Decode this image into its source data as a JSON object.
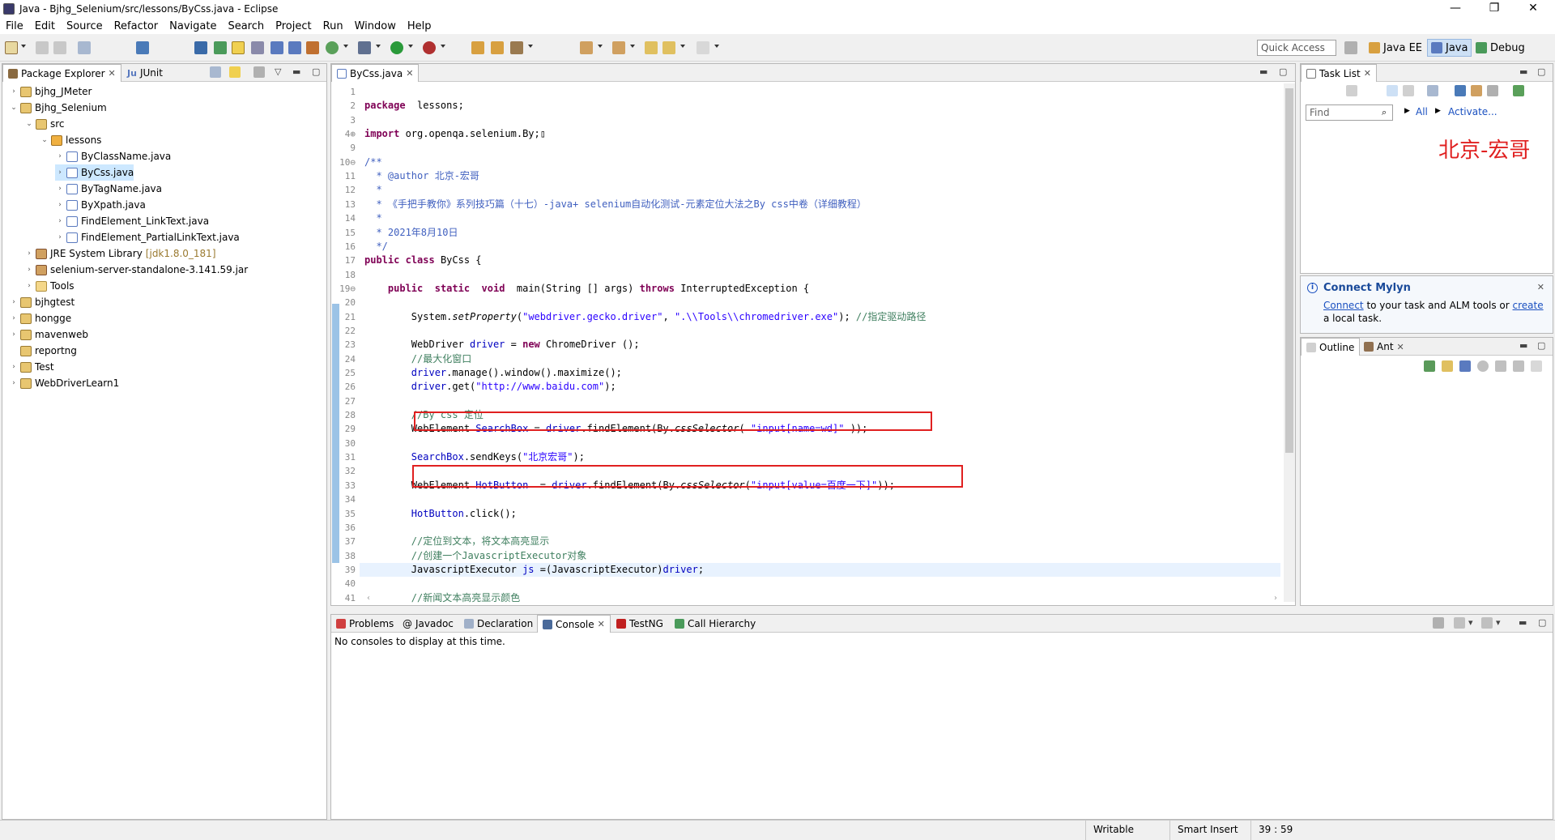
{
  "window": {
    "title": "Java - Bjhg_Selenium/src/lessons/ByCss.java - Eclipse",
    "minimize": "—",
    "maximize": "❐",
    "close": "✕"
  },
  "menu": [
    "File",
    "Edit",
    "Source",
    "Refactor",
    "Navigate",
    "Search",
    "Project",
    "Run",
    "Window",
    "Help"
  ],
  "quick_access": {
    "placeholder": "Quick Access"
  },
  "perspectives": [
    "Java EE",
    "Java",
    "Debug"
  ],
  "package_explorer": {
    "tabs": [
      "Package Explorer",
      "JUnit"
    ],
    "junit_prefix": "Ju",
    "tree": [
      {
        "label": "bjhg_JMeter",
        "level": 0,
        "twisty": "›",
        "icon": "proj"
      },
      {
        "label": "Bjhg_Selenium",
        "level": 0,
        "twisty": "⌄",
        "icon": "proj"
      },
      {
        "label": "src",
        "level": 1,
        "twisty": "⌄",
        "icon": "src"
      },
      {
        "label": "lessons",
        "level": 2,
        "twisty": "⌄",
        "icon": "pkg"
      },
      {
        "label": "ByClassName.java",
        "level": 3,
        "twisty": "›",
        "icon": "java"
      },
      {
        "label": "ByCss.java",
        "level": 3,
        "twisty": "›",
        "icon": "java",
        "selected": true
      },
      {
        "label": "ByTagName.java",
        "level": 3,
        "twisty": "›",
        "icon": "java"
      },
      {
        "label": "ByXpath.java",
        "level": 3,
        "twisty": "›",
        "icon": "java"
      },
      {
        "label": "FindElement_LinkText.java",
        "level": 3,
        "twisty": "›",
        "icon": "java"
      },
      {
        "label": "FindElement_PartialLinkText.java",
        "level": 3,
        "twisty": "›",
        "icon": "java"
      },
      {
        "label": "JRE System Library",
        "suffix": "[jdk1.8.0_181]",
        "level": 1,
        "twisty": "›",
        "icon": "lib"
      },
      {
        "label": "selenium-server-standalone-3.141.59.jar",
        "level": 1,
        "twisty": "›",
        "icon": "lib"
      },
      {
        "label": "Tools",
        "level": 1,
        "twisty": "›",
        "icon": "folder"
      },
      {
        "label": "bjhgtest",
        "level": 0,
        "twisty": "›",
        "icon": "proj"
      },
      {
        "label": "hongge",
        "level": 0,
        "twisty": "›",
        "icon": "proj"
      },
      {
        "label": "mavenweb",
        "level": 0,
        "twisty": "›",
        "icon": "proj"
      },
      {
        "label": "reportng",
        "level": 0,
        "twisty": "",
        "icon": "proj"
      },
      {
        "label": "Test",
        "level": 0,
        "twisty": "›",
        "icon": "proj"
      },
      {
        "label": "WebDriverLearn1",
        "level": 0,
        "twisty": "›",
        "icon": "proj"
      }
    ]
  },
  "editor": {
    "tab": "ByCss.java",
    "lines": [
      {
        "n": "1",
        "t": []
      },
      {
        "n": "2",
        "t": [
          [
            "kw",
            "package"
          ],
          [
            "",
            "  lessons;"
          ]
        ]
      },
      {
        "n": "3",
        "t": []
      },
      {
        "n": "4⊕",
        "t": [
          [
            "kw",
            "import"
          ],
          [
            "",
            " org.openqa.selenium.By;"
          ],
          [
            "",
            "▯"
          ]
        ]
      },
      {
        "n": "9",
        "t": []
      },
      {
        "n": "10⊖",
        "t": [
          [
            "doc",
            "/**"
          ]
        ]
      },
      {
        "n": "11",
        "t": [
          [
            "doc",
            "  * "
          ],
          [
            "doc",
            "@author"
          ],
          [
            "doc",
            " 北京-宏哥"
          ]
        ]
      },
      {
        "n": "12",
        "t": [
          [
            "doc",
            "  *"
          ]
        ]
      },
      {
        "n": "13",
        "t": [
          [
            "doc",
            "  * 《手把手教你》系列技巧篇（十七）-java+ selenium自动化测试-元素定位大法之By css中卷（详细教程）"
          ]
        ]
      },
      {
        "n": "14",
        "t": [
          [
            "doc",
            "  *"
          ]
        ]
      },
      {
        "n": "15",
        "t": [
          [
            "doc",
            "  * 2021年8月10日"
          ]
        ]
      },
      {
        "n": "16",
        "t": [
          [
            "doc",
            "  */"
          ]
        ]
      },
      {
        "n": "17",
        "t": [
          [
            "kw",
            "public"
          ],
          [
            "",
            " "
          ],
          [
            "kw",
            "class"
          ],
          [
            "",
            " ByCss {"
          ]
        ]
      },
      {
        "n": "18",
        "t": []
      },
      {
        "n": "19⊖",
        "t": [
          [
            "",
            "    "
          ],
          [
            "kw",
            "public"
          ],
          [
            "",
            "  "
          ],
          [
            "kw",
            "static"
          ],
          [
            "",
            "  "
          ],
          [
            "kw",
            "void"
          ],
          [
            "",
            "  main(String [] args) "
          ],
          [
            "kw",
            "throws"
          ],
          [
            "",
            " InterruptedException {"
          ]
        ]
      },
      {
        "n": "20",
        "t": []
      },
      {
        "n": "21",
        "t": [
          [
            "",
            "        System."
          ],
          [
            "ital",
            "setProperty"
          ],
          [
            "",
            "("
          ],
          [
            "str",
            "\"webdriver.gecko.driver\""
          ],
          [
            "",
            ", "
          ],
          [
            "str",
            "\".\\\\Tools\\\\chromedriver.exe\""
          ],
          [
            "",
            "); "
          ],
          [
            "cmt",
            "//指定驱动路径"
          ]
        ]
      },
      {
        "n": "22",
        "t": []
      },
      {
        "n": "23",
        "t": [
          [
            "",
            "        WebDriver "
          ],
          [
            "var",
            "driver"
          ],
          [
            "",
            " = "
          ],
          [
            "kw",
            "new"
          ],
          [
            "",
            " ChromeDriver ();"
          ]
        ]
      },
      {
        "n": "24",
        "t": [
          [
            "cmt",
            "        //最大化窗口"
          ]
        ]
      },
      {
        "n": "25",
        "t": [
          [
            "var",
            "        driver"
          ],
          [
            "",
            ".manage().window().maximize();"
          ]
        ]
      },
      {
        "n": "26",
        "t": [
          [
            "var",
            "        driver"
          ],
          [
            "",
            ".get("
          ],
          [
            "str",
            "\"http://www.baidu.com\""
          ],
          [
            "",
            ");"
          ]
        ]
      },
      {
        "n": "27",
        "t": []
      },
      {
        "n": "28",
        "t": [
          [
            "cmt",
            "        //By css 定位"
          ]
        ]
      },
      {
        "n": "29",
        "t": [
          [
            "",
            "        WebElement "
          ],
          [
            "var",
            "SearchBox"
          ],
          [
            "",
            " = "
          ],
          [
            "var",
            "driver"
          ],
          [
            "",
            ".findElement(By."
          ],
          [
            "ital",
            "cssSelector"
          ],
          [
            "",
            "( "
          ],
          [
            "str",
            "\"input[name=wd]\""
          ],
          [
            "",
            " ));"
          ]
        ]
      },
      {
        "n": "30",
        "t": []
      },
      {
        "n": "31",
        "t": [
          [
            "var",
            "        SearchBox"
          ],
          [
            "",
            ".sendKeys("
          ],
          [
            "str",
            "\"北京宏哥\""
          ],
          [
            "",
            ");"
          ]
        ]
      },
      {
        "n": "32",
        "t": []
      },
      {
        "n": "33",
        "t": [
          [
            "",
            "        WebElement "
          ],
          [
            "var",
            "HotButton"
          ],
          [
            "",
            "  = "
          ],
          [
            "var",
            "driver"
          ],
          [
            "",
            ".findElement(By."
          ],
          [
            "ital",
            "cssSelector"
          ],
          [
            "",
            "("
          ],
          [
            "str",
            "\"input[value=百度一下]\""
          ],
          [
            "",
            "));"
          ]
        ]
      },
      {
        "n": "34",
        "t": []
      },
      {
        "n": "35",
        "t": [
          [
            "var",
            "        HotButton"
          ],
          [
            "",
            ".click();"
          ]
        ]
      },
      {
        "n": "36",
        "t": []
      },
      {
        "n": "37",
        "t": [
          [
            "cmt",
            "        //定位到文本，将文本高亮显示"
          ]
        ]
      },
      {
        "n": "38",
        "t": [
          [
            "cmt",
            "        //创建一个JavascriptExecutor对象"
          ]
        ]
      },
      {
        "n": "39",
        "t": [
          [
            "",
            "        JavascriptExecutor "
          ],
          [
            "var",
            "js"
          ],
          [
            "",
            " =(JavascriptExecutor)"
          ],
          [
            "var",
            "driver"
          ],
          [
            "",
            ";"
          ]
        ],
        "current": true
      },
      {
        "n": "40",
        "t": []
      },
      {
        "n": "41",
        "t": [
          [
            "cmt",
            "        //新闻文本高亮显示颜色"
          ]
        ]
      }
    ]
  },
  "task_list": {
    "tab": "Task List",
    "find_placeholder": "Find",
    "all": "All",
    "activate": "Activate...",
    "watermark": "北京-宏哥"
  },
  "mylyn": {
    "title": "Connect Mylyn",
    "info_icon": "i",
    "connect": "Connect",
    "middle": " to your task and ALM tools or ",
    "create": "create",
    "end": "a local task."
  },
  "outline": {
    "tabs": [
      "Outline",
      "Ant"
    ]
  },
  "console": {
    "tabs": [
      "Problems",
      "Javadoc",
      "Declaration",
      "Console",
      "TestNG",
      "Call Hierarchy"
    ],
    "message": "No consoles to display at this time."
  },
  "status": {
    "writable": "Writable",
    "insert_mode": "Smart Insert",
    "position": "39 : 59"
  },
  "colors": {
    "accent_red": "#e02020",
    "keyword": "#7f0055",
    "string": "#2a00ff",
    "comment": "#3f7f5f"
  }
}
